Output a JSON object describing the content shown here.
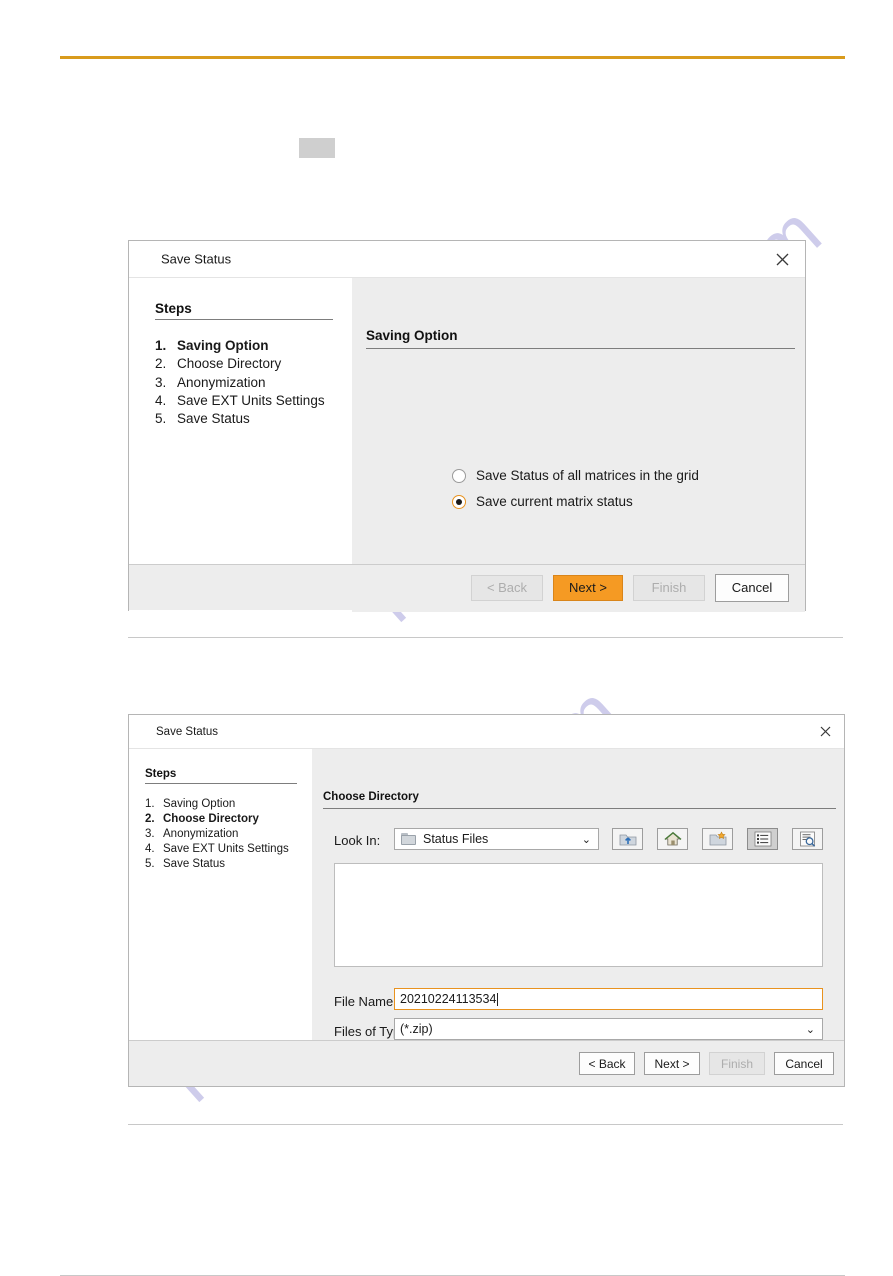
{
  "page": {
    "watermark_text": "manualshive.com",
    "accent_color": "#d99b1c"
  },
  "dialog1": {
    "title": "Save Status",
    "close_icon": "close-icon",
    "steps_header": "Steps",
    "steps": [
      {
        "num": "1.",
        "label": "Saving Option",
        "active": true
      },
      {
        "num": "2.",
        "label": "Choose Directory",
        "active": false
      },
      {
        "num": "3.",
        "label": "Anonymization",
        "active": false
      },
      {
        "num": "4.",
        "label": "Save EXT Units Settings",
        "active": false
      },
      {
        "num": "5.",
        "label": "Save Status",
        "active": false
      }
    ],
    "content_header": "Saving Option",
    "options": [
      {
        "label": "Save Status of all matrices in the grid",
        "selected": false
      },
      {
        "label": "Save current matrix status",
        "selected": true
      }
    ],
    "buttons": {
      "back": "< Back",
      "next": "Next >",
      "finish": "Finish",
      "cancel": "Cancel"
    }
  },
  "dialog2": {
    "title": "Save Status",
    "close_icon": "close-icon",
    "steps_header": "Steps",
    "steps": [
      {
        "num": "1.",
        "label": "Saving Option",
        "active": false
      },
      {
        "num": "2.",
        "label": "Choose Directory",
        "active": true
      },
      {
        "num": "3.",
        "label": "Anonymization",
        "active": false
      },
      {
        "num": "4.",
        "label": "Save EXT Units Settings",
        "active": false
      },
      {
        "num": "5.",
        "label": "Save Status",
        "active": false
      }
    ],
    "content_header": "Choose Directory",
    "look_in": {
      "label": "Look In:",
      "value": "Status Files",
      "caret": "⌄"
    },
    "toolbar": [
      {
        "name": "up-one-level-icon",
        "pressed": false
      },
      {
        "name": "home-icon",
        "pressed": false
      },
      {
        "name": "new-folder-icon",
        "pressed": false
      },
      {
        "name": "list-view-icon",
        "pressed": true
      },
      {
        "name": "details-view-icon",
        "pressed": false
      }
    ],
    "file_list": {
      "items": []
    },
    "file_name": {
      "label": "File Name:",
      "value": "20210224113534"
    },
    "files_of_type": {
      "label": "Files of Type:",
      "value": "(*.zip)",
      "caret": "⌄"
    },
    "buttons": {
      "back": "< Back",
      "next": "Next >",
      "finish": "Finish",
      "cancel": "Cancel"
    }
  }
}
